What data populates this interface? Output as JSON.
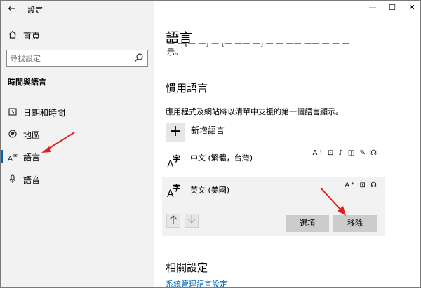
{
  "app": {
    "title": "設定",
    "back": "←"
  },
  "sidebar": {
    "home_label": "首頁",
    "search_placeholder": "尋找設定",
    "section_heading": "時間與語言",
    "items": [
      {
        "label": "日期和時間",
        "icon": "clock-icon"
      },
      {
        "label": "地區",
        "icon": "globe-icon"
      },
      {
        "label": "語言",
        "icon": "language-icon",
        "active": true
      },
      {
        "label": "語音",
        "icon": "microphone-icon"
      }
    ]
  },
  "window_controls": {
    "minimize": "—",
    "maximize": "☐",
    "close": "✕"
  },
  "main": {
    "title": "語言",
    "cut_text_line1": "— —[— —] — [— —— —] — — —— —— — — —",
    "cut_text_line2": "示。",
    "preferred_title": "慣用語言",
    "preferred_desc": "應用程式及網站將以清單中支援的第一個語言顯示。",
    "add_language_label": "新增語言",
    "languages": [
      {
        "name": "中文 (繁體，台灣)",
        "features": "A⁺ ⊡ ♪ ◫ ✎ ☊"
      },
      {
        "name": "英文 (美國)",
        "features": "A⁺ ⊡ ☊"
      }
    ],
    "options_button": "選項",
    "remove_button": "移除",
    "related_title": "相關設定",
    "related_link": "系統管理語言設定"
  }
}
